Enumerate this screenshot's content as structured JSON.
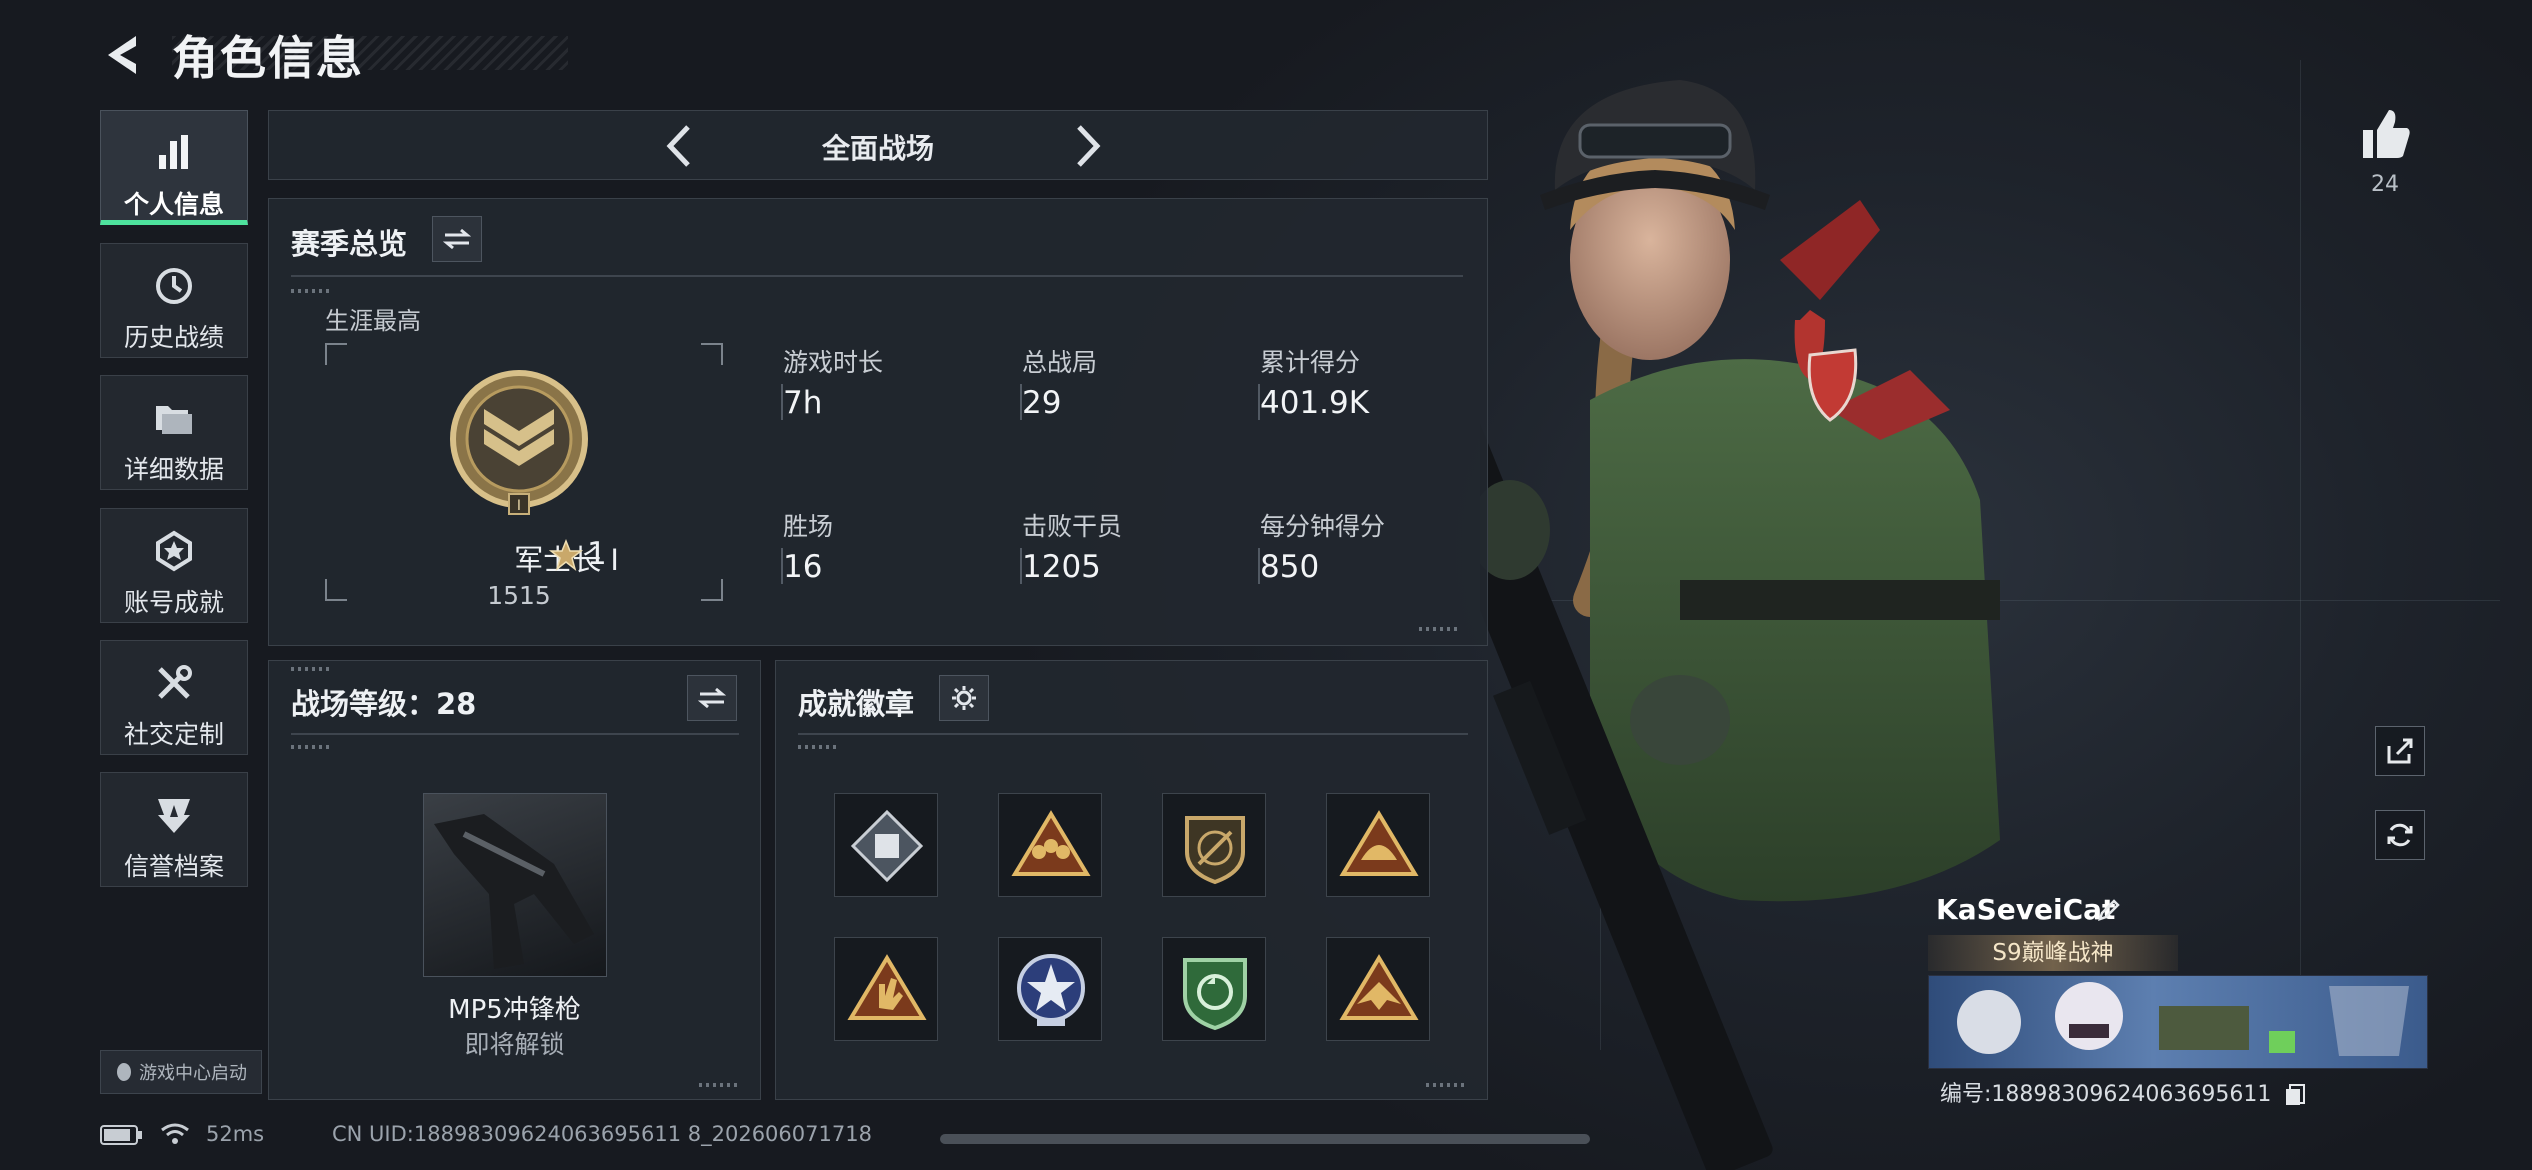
{
  "header": {
    "title": "角色信息"
  },
  "nav": {
    "items": [
      {
        "label": "个人信息",
        "icon": "bar-chart-icon",
        "active": true
      },
      {
        "label": "历史战绩",
        "icon": "clock-icon",
        "active": false
      },
      {
        "label": "详细数据",
        "icon": "folder-icon",
        "active": false
      },
      {
        "label": "账号成就",
        "icon": "medal-icon",
        "active": false
      },
      {
        "label": "社交定制",
        "icon": "tools-icon",
        "active": false
      },
      {
        "label": "信誉档案",
        "icon": "shield-icon",
        "active": false
      }
    ],
    "launch_label": "游戏中心启动"
  },
  "mode_selector": {
    "current": "全面战场"
  },
  "season_overview": {
    "title": "赛季总览",
    "career_best_label": "生涯最高",
    "rank_name": "军士长 Ⅰ",
    "rank_stars": "1",
    "rank_points": "1515",
    "stats": [
      {
        "label": "游戏时长",
        "value": "7h"
      },
      {
        "label": "总战局",
        "value": "29"
      },
      {
        "label": "累计得分",
        "value": "401.9K"
      },
      {
        "label": "胜场",
        "value": "16"
      },
      {
        "label": "击败干员",
        "value": "1205"
      },
      {
        "label": "每分钟得分",
        "value": "850"
      }
    ]
  },
  "battlefield_level": {
    "title": "战场等级：28",
    "weapon_name": "MP5冲锋枪",
    "weapon_status": "即将解锁"
  },
  "achievements": {
    "title": "成就徽章",
    "badges": [
      "diamond-badge-icon",
      "triangle-squad-badge-icon",
      "shield-rifle-badge-icon",
      "triangle-helmet-badge-icon",
      "triangle-hand-badge-icon",
      "star-circle-badge-icon",
      "green-shield-badge-icon",
      "triangle-eagle-badge-icon"
    ]
  },
  "profile": {
    "like_count": "24",
    "nickname": "KaSeveiCat",
    "title": "S9巅峰战神",
    "id_line": "编号:18898309624063695611"
  },
  "status": {
    "ping": "52ms",
    "uid": "CN UID:18898309624063695611 8_202606071718"
  },
  "colors": {
    "accent": "#4ee29d",
    "gold": "#c9a86a",
    "panel": "#22272f"
  }
}
